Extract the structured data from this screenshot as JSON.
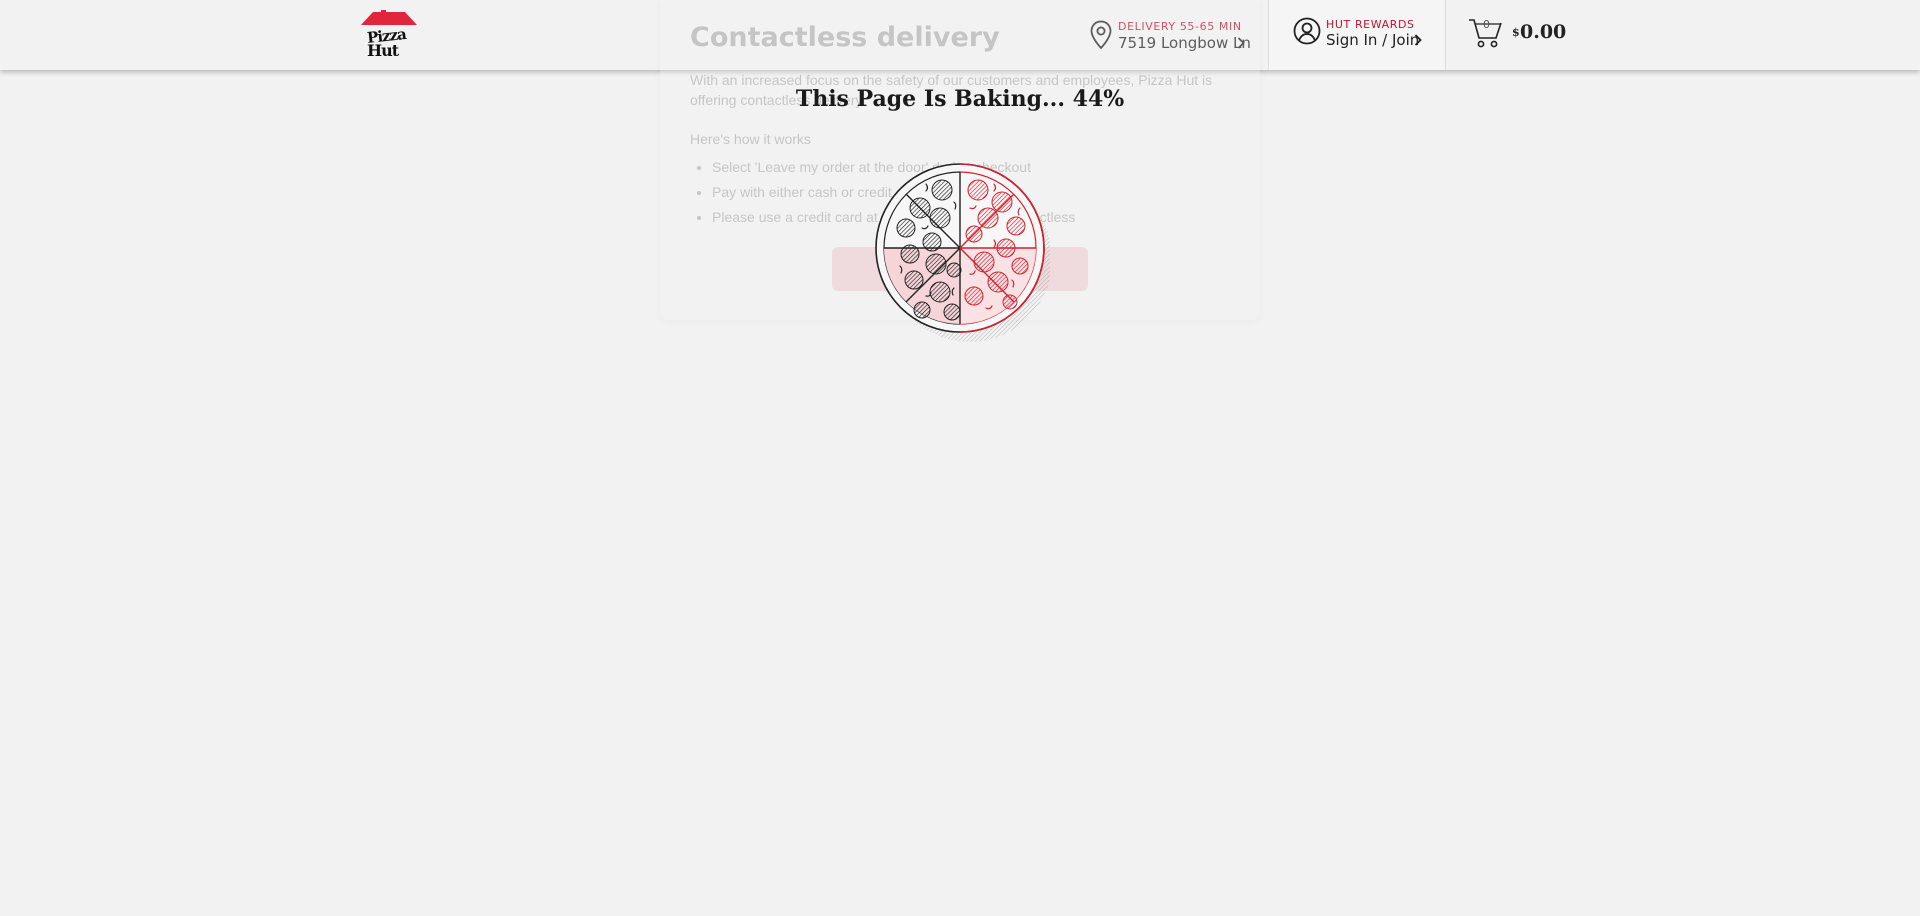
{
  "header": {
    "logo_line1": "Pizza",
    "logo_line2": "Hut",
    "delivery": {
      "label": "DELIVERY 55-65 MIN",
      "address": "7519 Longbow Ln"
    },
    "rewards": {
      "label": "HUT REWARDS",
      "action": "Sign In / Join"
    },
    "cart": {
      "count": "0",
      "currency": "$",
      "amount": "0.00"
    }
  },
  "modal": {
    "title": "Contactless delivery",
    "intro": "With an increased focus on the safety of our customers and employees, Pizza Hut is offering contactless delivery.",
    "how_it_works": "Here's how it works",
    "steps": [
      "Select 'Leave my order at the door' during checkout",
      "Pay with either cash or credit card",
      "Please use a credit card at checkout to be fully contactless"
    ]
  },
  "loader": {
    "text": "This Page Is Baking... 44%",
    "progress_percent": 44
  },
  "colors": {
    "brand_red": "#c8102e",
    "background": "#f2f2f2",
    "text": "#222222"
  },
  "icons": [
    "location-pin-icon",
    "chevron-right-icon",
    "user-icon",
    "cart-icon",
    "pizza-loader-icon"
  ]
}
